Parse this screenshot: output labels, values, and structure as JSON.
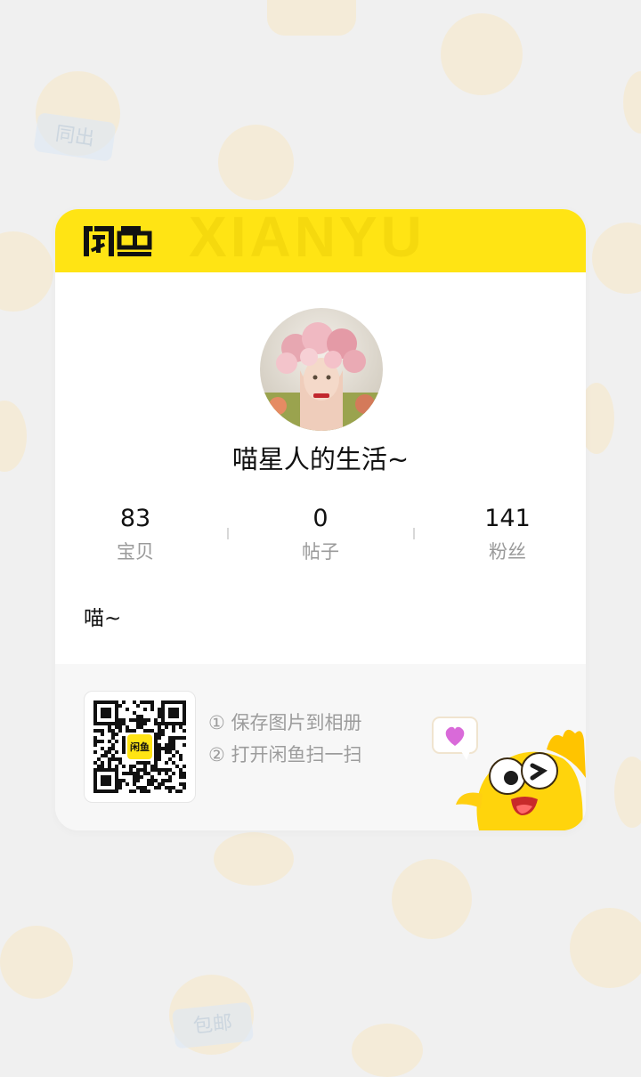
{
  "brand": {
    "logo_text": "闲鱼",
    "watermark": "XIANYU"
  },
  "profile": {
    "name": "喵星人的生活~",
    "bio": "喵~"
  },
  "stats": [
    {
      "value": "83",
      "label": "宝贝"
    },
    {
      "value": "0",
      "label": "帖子"
    },
    {
      "value": "141",
      "label": "粉丝"
    }
  ],
  "footer": {
    "step1": "① 保存图片到相册",
    "step2": "② 打开闲鱼扫一扫",
    "qr_center_text": "闲鱼"
  },
  "background": {
    "tag1": "同出",
    "tag2": "包邮"
  },
  "colors": {
    "brand_yellow": "#ffe414",
    "text_primary": "#111111",
    "text_secondary": "#9a9a9a",
    "heart": "#d96ad9"
  }
}
